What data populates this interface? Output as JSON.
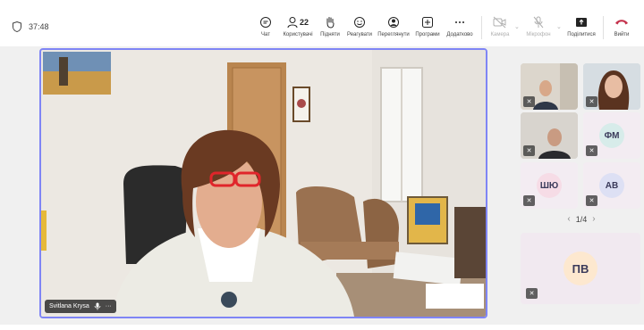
{
  "meeting": {
    "timer": "37:48"
  },
  "toolbar": {
    "items": [
      {
        "label": "Чат",
        "icon": "chat-icon"
      },
      {
        "label": "Користувачі",
        "icon": "people-icon",
        "count": "22"
      },
      {
        "label": "Підняти",
        "icon": "raise-hand-icon"
      },
      {
        "label": "Реагувати",
        "icon": "react-icon"
      },
      {
        "label": "Переглянути",
        "icon": "view-icon"
      },
      {
        "label": "Програми",
        "icon": "apps-icon"
      },
      {
        "label": "Додатково",
        "icon": "more-icon"
      },
      {
        "label": "Камера",
        "icon": "camera-off-icon"
      },
      {
        "label": "Мікрофон",
        "icon": "mic-off-icon"
      },
      {
        "label": "Поділитися",
        "icon": "share-icon"
      },
      {
        "label": "Вийти",
        "icon": "leave-icon"
      }
    ]
  },
  "main_video": {
    "speaker_name": "Svitlana Krysa",
    "more": "···"
  },
  "gallery": {
    "tiles": [
      {
        "initials": "ФМ",
        "color": "#d7ecea"
      },
      {
        "initials": "ШЮ",
        "color": "#f6dce6"
      },
      {
        "initials": "АВ",
        "color": "#dde0f4"
      },
      {
        "initials": "ПВ",
        "color": "#fde8cf"
      }
    ],
    "pager": "1/4"
  },
  "colors": {
    "accent": "#7f85f5",
    "leave": "#c4314b"
  }
}
